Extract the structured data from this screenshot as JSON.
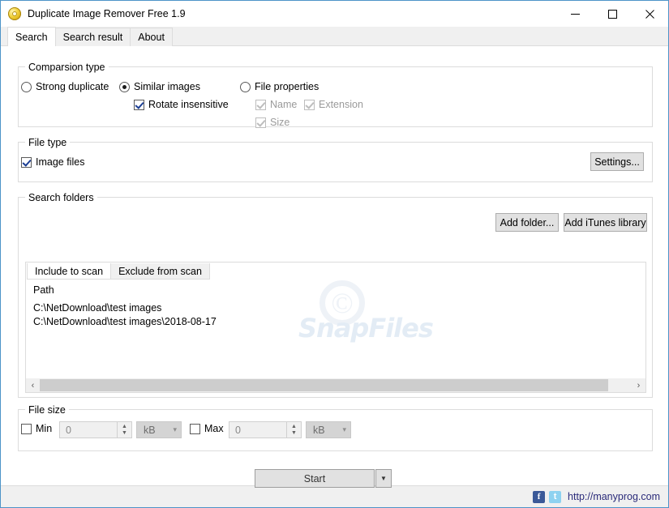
{
  "window": {
    "title": "Duplicate Image Remover Free 1.9",
    "icon": "disc-icon",
    "controls": {
      "minimize": "minimize-icon",
      "maximize": "maximize-icon",
      "close": "close-icon"
    }
  },
  "tabs": [
    {
      "label": "Search",
      "active": true
    },
    {
      "label": "Search result",
      "active": false
    },
    {
      "label": "About",
      "active": false
    }
  ],
  "comparison": {
    "group_title": "Comparsion type",
    "strong_duplicate": {
      "label": "Strong duplicate",
      "checked": false
    },
    "similar_images": {
      "label": "Similar images",
      "checked": true
    },
    "rotate_insensitive": {
      "label": "Rotate insensitive",
      "checked": true
    },
    "file_properties": {
      "label": "File properties",
      "checked": false
    },
    "name": {
      "label": "Name",
      "checked": true,
      "disabled": true
    },
    "extension": {
      "label": "Extension",
      "checked": true,
      "disabled": true
    },
    "size": {
      "label": "Size",
      "checked": true,
      "disabled": true
    }
  },
  "file_type": {
    "group_title": "File type",
    "image_files": {
      "label": "Image files",
      "checked": true
    },
    "settings_button": "Settings..."
  },
  "search_folders": {
    "group_title": "Search folders",
    "add_folder_button": "Add folder...",
    "add_itunes_button": "Add iTunes library",
    "inner_tabs": [
      {
        "label": "Include to scan",
        "active": true
      },
      {
        "label": "Exclude from scan",
        "active": false
      }
    ],
    "column_header": "Path",
    "rows": [
      "C:\\NetDownload\\test images",
      "C:\\NetDownload\\test images\\2018-08-17"
    ],
    "scrollbar": {
      "left_arrow": "chevron-left-icon",
      "right_arrow": "chevron-right-icon"
    },
    "watermark": {
      "symbol": "©",
      "text": "SnapFiles"
    }
  },
  "file_size": {
    "group_title": "File size",
    "min": {
      "label": "Min",
      "checked": false,
      "value": "0",
      "unit": "kB"
    },
    "max": {
      "label": "Max",
      "checked": false,
      "value": "0",
      "unit": "kB"
    }
  },
  "actions": {
    "start_button": "Start",
    "start_dropdown": "chevron-down-icon"
  },
  "statusbar": {
    "facebook_icon": "f",
    "twitter_icon": "t",
    "url": "http://manyprog.com"
  },
  "colors": {
    "window_border": "#4d94c8",
    "group_border": "#dcdcdc",
    "button_face": "#e1e1e1",
    "link": "#2b2b7a",
    "check_mark": "#1c3f94",
    "disabled_text": "#9a9a9a"
  }
}
